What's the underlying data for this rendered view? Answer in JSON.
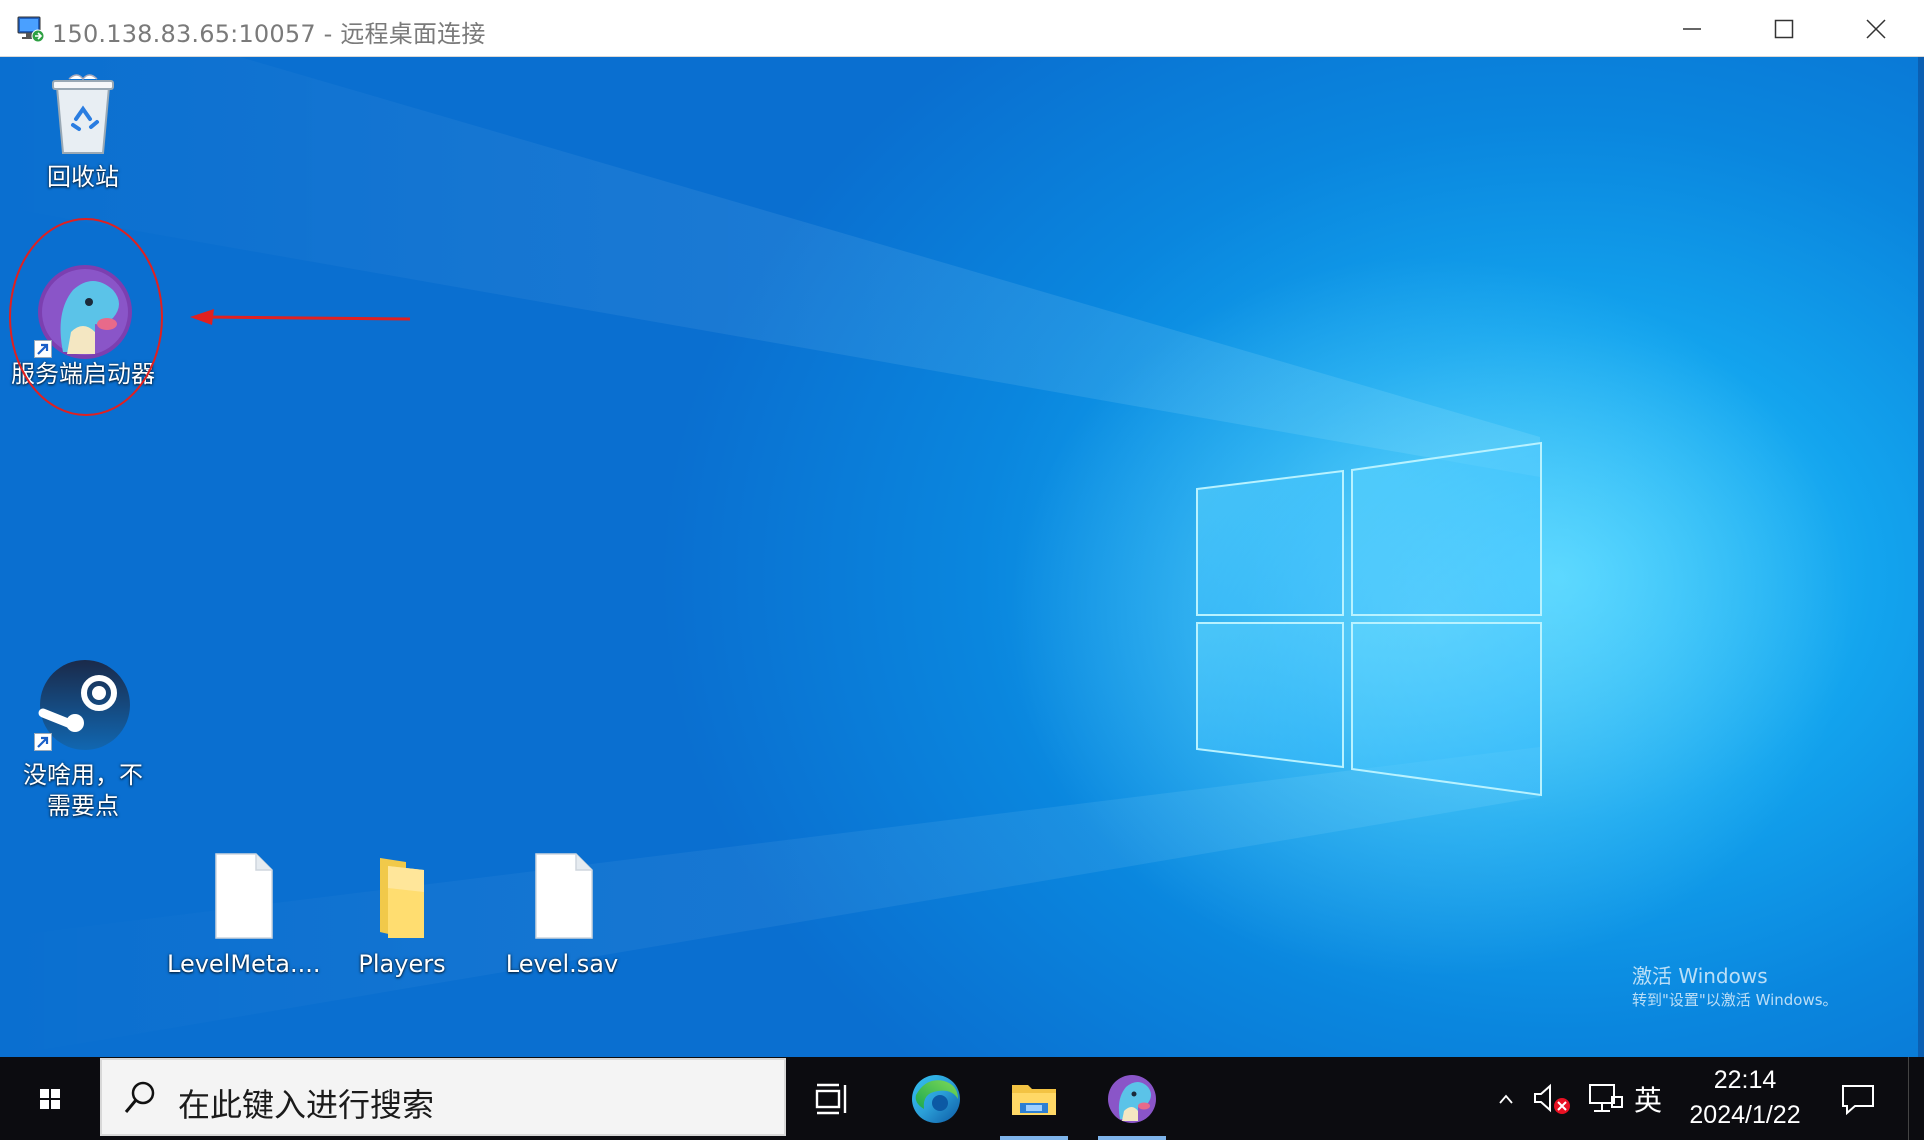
{
  "window": {
    "title": "150.138.83.65:10057 - 远程桌面连接",
    "controls": [
      "minimize",
      "maximize",
      "close"
    ]
  },
  "desktop": {
    "icons": [
      {
        "label": "回收站",
        "icon": "recycle-bin-icon",
        "shortcut": false
      },
      {
        "label": "服务端启动器",
        "icon": "palworld-launcher-icon",
        "shortcut": true,
        "highlighted": true
      },
      {
        "label": "没啥用，不需要点",
        "icon": "steam-icon",
        "shortcut": true
      },
      {
        "label": "LevelMeta....",
        "icon": "file-icon",
        "shortcut": false
      },
      {
        "label": "Players",
        "icon": "folder-icon",
        "shortcut": false
      },
      {
        "label": "Level.sav",
        "icon": "file-icon",
        "shortcut": false
      }
    ],
    "annotation": {
      "shape": "red-ellipse",
      "arrow": "red-arrow-pointing-left",
      "color": "#e02020"
    },
    "watermark": {
      "line1": "激活 Windows",
      "line2": "转到\"设置\"以激活 Windows。"
    }
  },
  "taskbar": {
    "search_placeholder": "在此键入进行搜索",
    "apps": [
      "task-view-icon",
      "edge-icon",
      "file-explorer-icon",
      "palworld-launcher-icon"
    ],
    "tray": {
      "ime": "英",
      "time": "22:14",
      "date": "2024/1/22",
      "icons": [
        "chevron-up-icon",
        "volume-muted-icon",
        "network-icon",
        "notification-icon"
      ]
    }
  },
  "colors": {
    "desktop_blue": "#0a86de",
    "taskbar": "#0c0c10",
    "annotation_red": "#e02020"
  }
}
